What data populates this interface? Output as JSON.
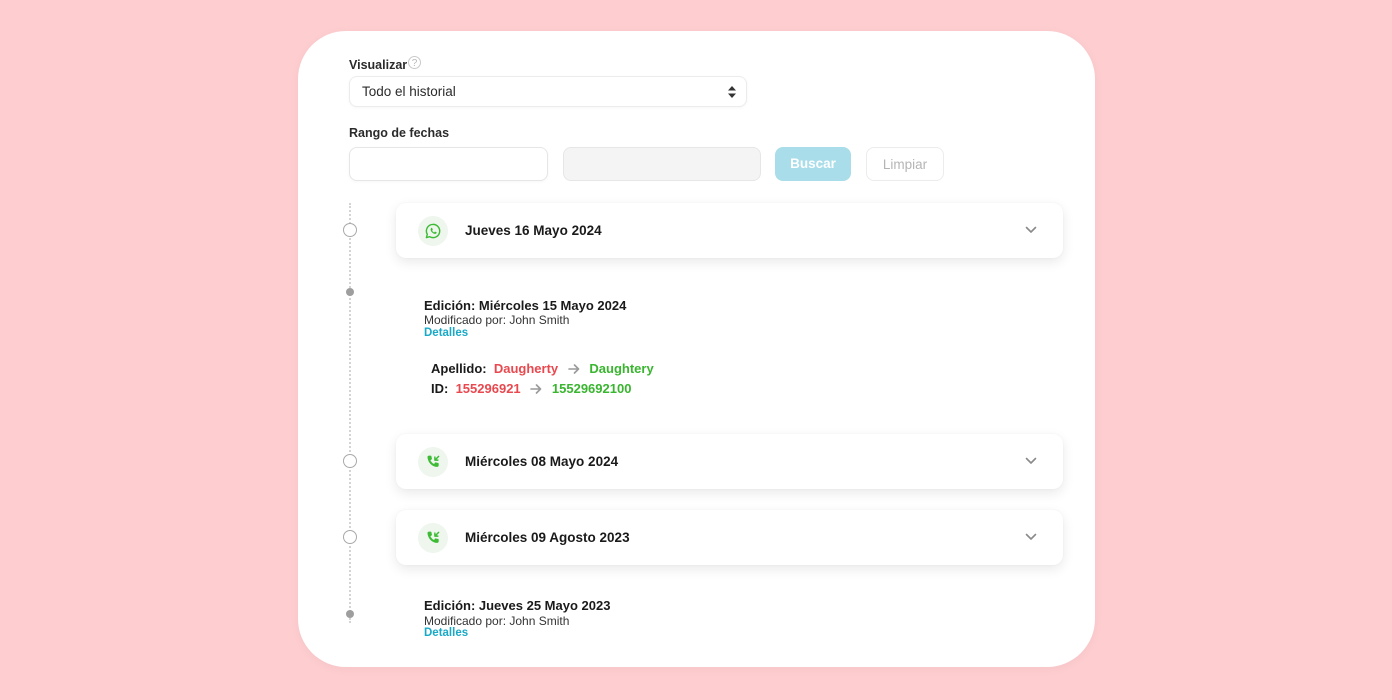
{
  "filter": {
    "view_label": "Visualizar",
    "view_value": "Todo el historial",
    "range_label": "Rango de fechas",
    "search_label": "Buscar",
    "clear_label": "Limpiar"
  },
  "colors": {
    "background": "#fecdcf",
    "search_button": "#a8dde9",
    "link": "#19a9c7",
    "old_value": "#e8484e",
    "new_value": "#39b52f",
    "icon_green": "#3dbb35"
  },
  "timeline": {
    "entries": [
      {
        "type": "whatsapp",
        "icon": "whatsapp-icon",
        "title": "Jueves 16 Mayo 2024"
      },
      {
        "type": "edit",
        "title": "Edición: Miércoles 15 Mayo 2024",
        "modified_by": "Modificado por: John Smith",
        "details_label": "Detalles",
        "changes": [
          {
            "field": "Apellido:",
            "old": "Daugherty",
            "new": "Daughtery"
          },
          {
            "field": "ID:",
            "old": "155296921",
            "new": "15529692100"
          }
        ]
      },
      {
        "type": "call",
        "icon": "incoming-call-icon",
        "title": "Miércoles 08 Mayo 2024"
      },
      {
        "type": "call",
        "icon": "incoming-call-icon",
        "title": "Miércoles 09 Agosto 2023"
      },
      {
        "type": "edit",
        "title": "Edición: Jueves 25 Mayo 2023",
        "modified_by": "Modificado por: John Smith",
        "details_label": "Detalles"
      }
    ]
  }
}
